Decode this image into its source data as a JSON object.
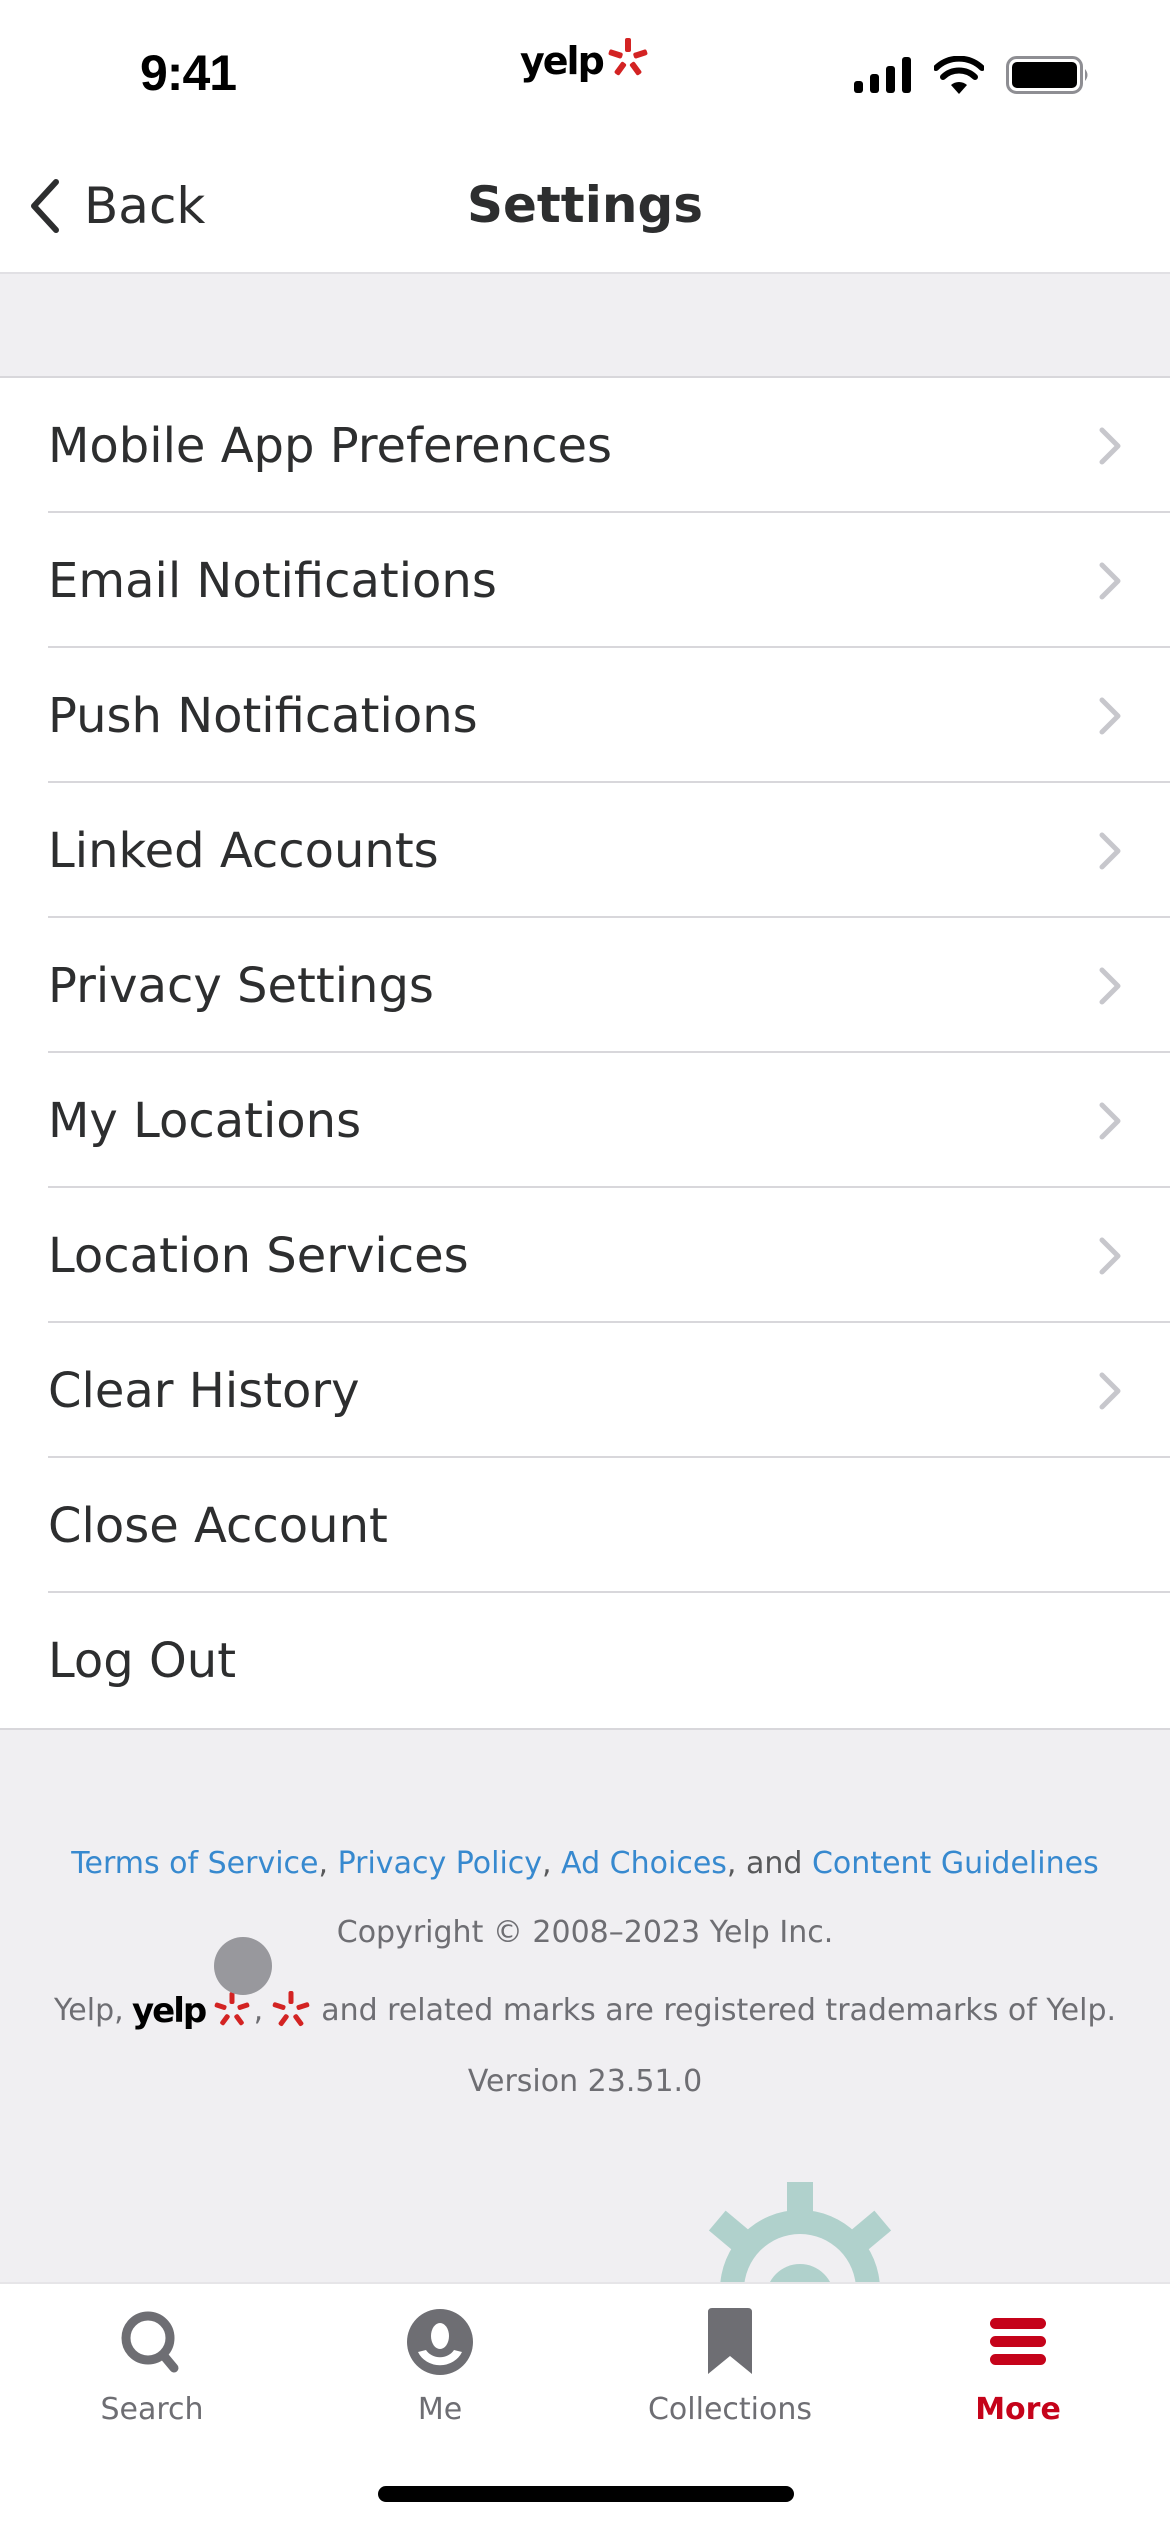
{
  "status_bar": {
    "time": "9:41",
    "logo": "yelp",
    "icons": [
      "cellular-signal-icon",
      "wifi-icon",
      "battery-icon"
    ]
  },
  "header": {
    "back_label": "Back",
    "title": "Settings"
  },
  "settings": {
    "items": [
      {
        "label": "Mobile App Preferences",
        "chevron": true
      },
      {
        "label": "Email Notifications",
        "chevron": true
      },
      {
        "label": "Push Notifications",
        "chevron": true
      },
      {
        "label": "Linked Accounts",
        "chevron": true
      },
      {
        "label": "Privacy Settings",
        "chevron": true
      },
      {
        "label": "My Locations",
        "chevron": true
      },
      {
        "label": "Location Services",
        "chevron": true
      },
      {
        "label": "Clear History",
        "chevron": true
      },
      {
        "label": "Close Account",
        "chevron": false
      },
      {
        "label": "Log Out",
        "chevron": false
      }
    ]
  },
  "footer": {
    "links": {
      "terms": "Terms of Service",
      "privacy": "Privacy Policy",
      "ad_choices": "Ad Choices",
      "content_guidelines": "Content Guidelines",
      "sep1": ", ",
      "sep2": ", ",
      "sep3": ", and "
    },
    "copyright": "Copyright © 2008–2023 Yelp Inc.",
    "trademark_prefix": "Yelp,",
    "trademark_suffix": "and related marks are registered trademarks of Yelp.",
    "version": "Version 23.51.0"
  },
  "tab_bar": {
    "tabs": [
      {
        "label": "Search",
        "icon": "search-icon",
        "active": false
      },
      {
        "label": "Me",
        "icon": "profile-icon",
        "active": false
      },
      {
        "label": "Collections",
        "icon": "bookmark-icon",
        "active": false
      },
      {
        "label": "More",
        "icon": "menu-icon",
        "active": true
      }
    ]
  },
  "colors": {
    "brand_red": "#d32323",
    "active_tab": "#c5031a",
    "link_blue": "#3789cf",
    "gear_tint": "#b0d1cc"
  }
}
